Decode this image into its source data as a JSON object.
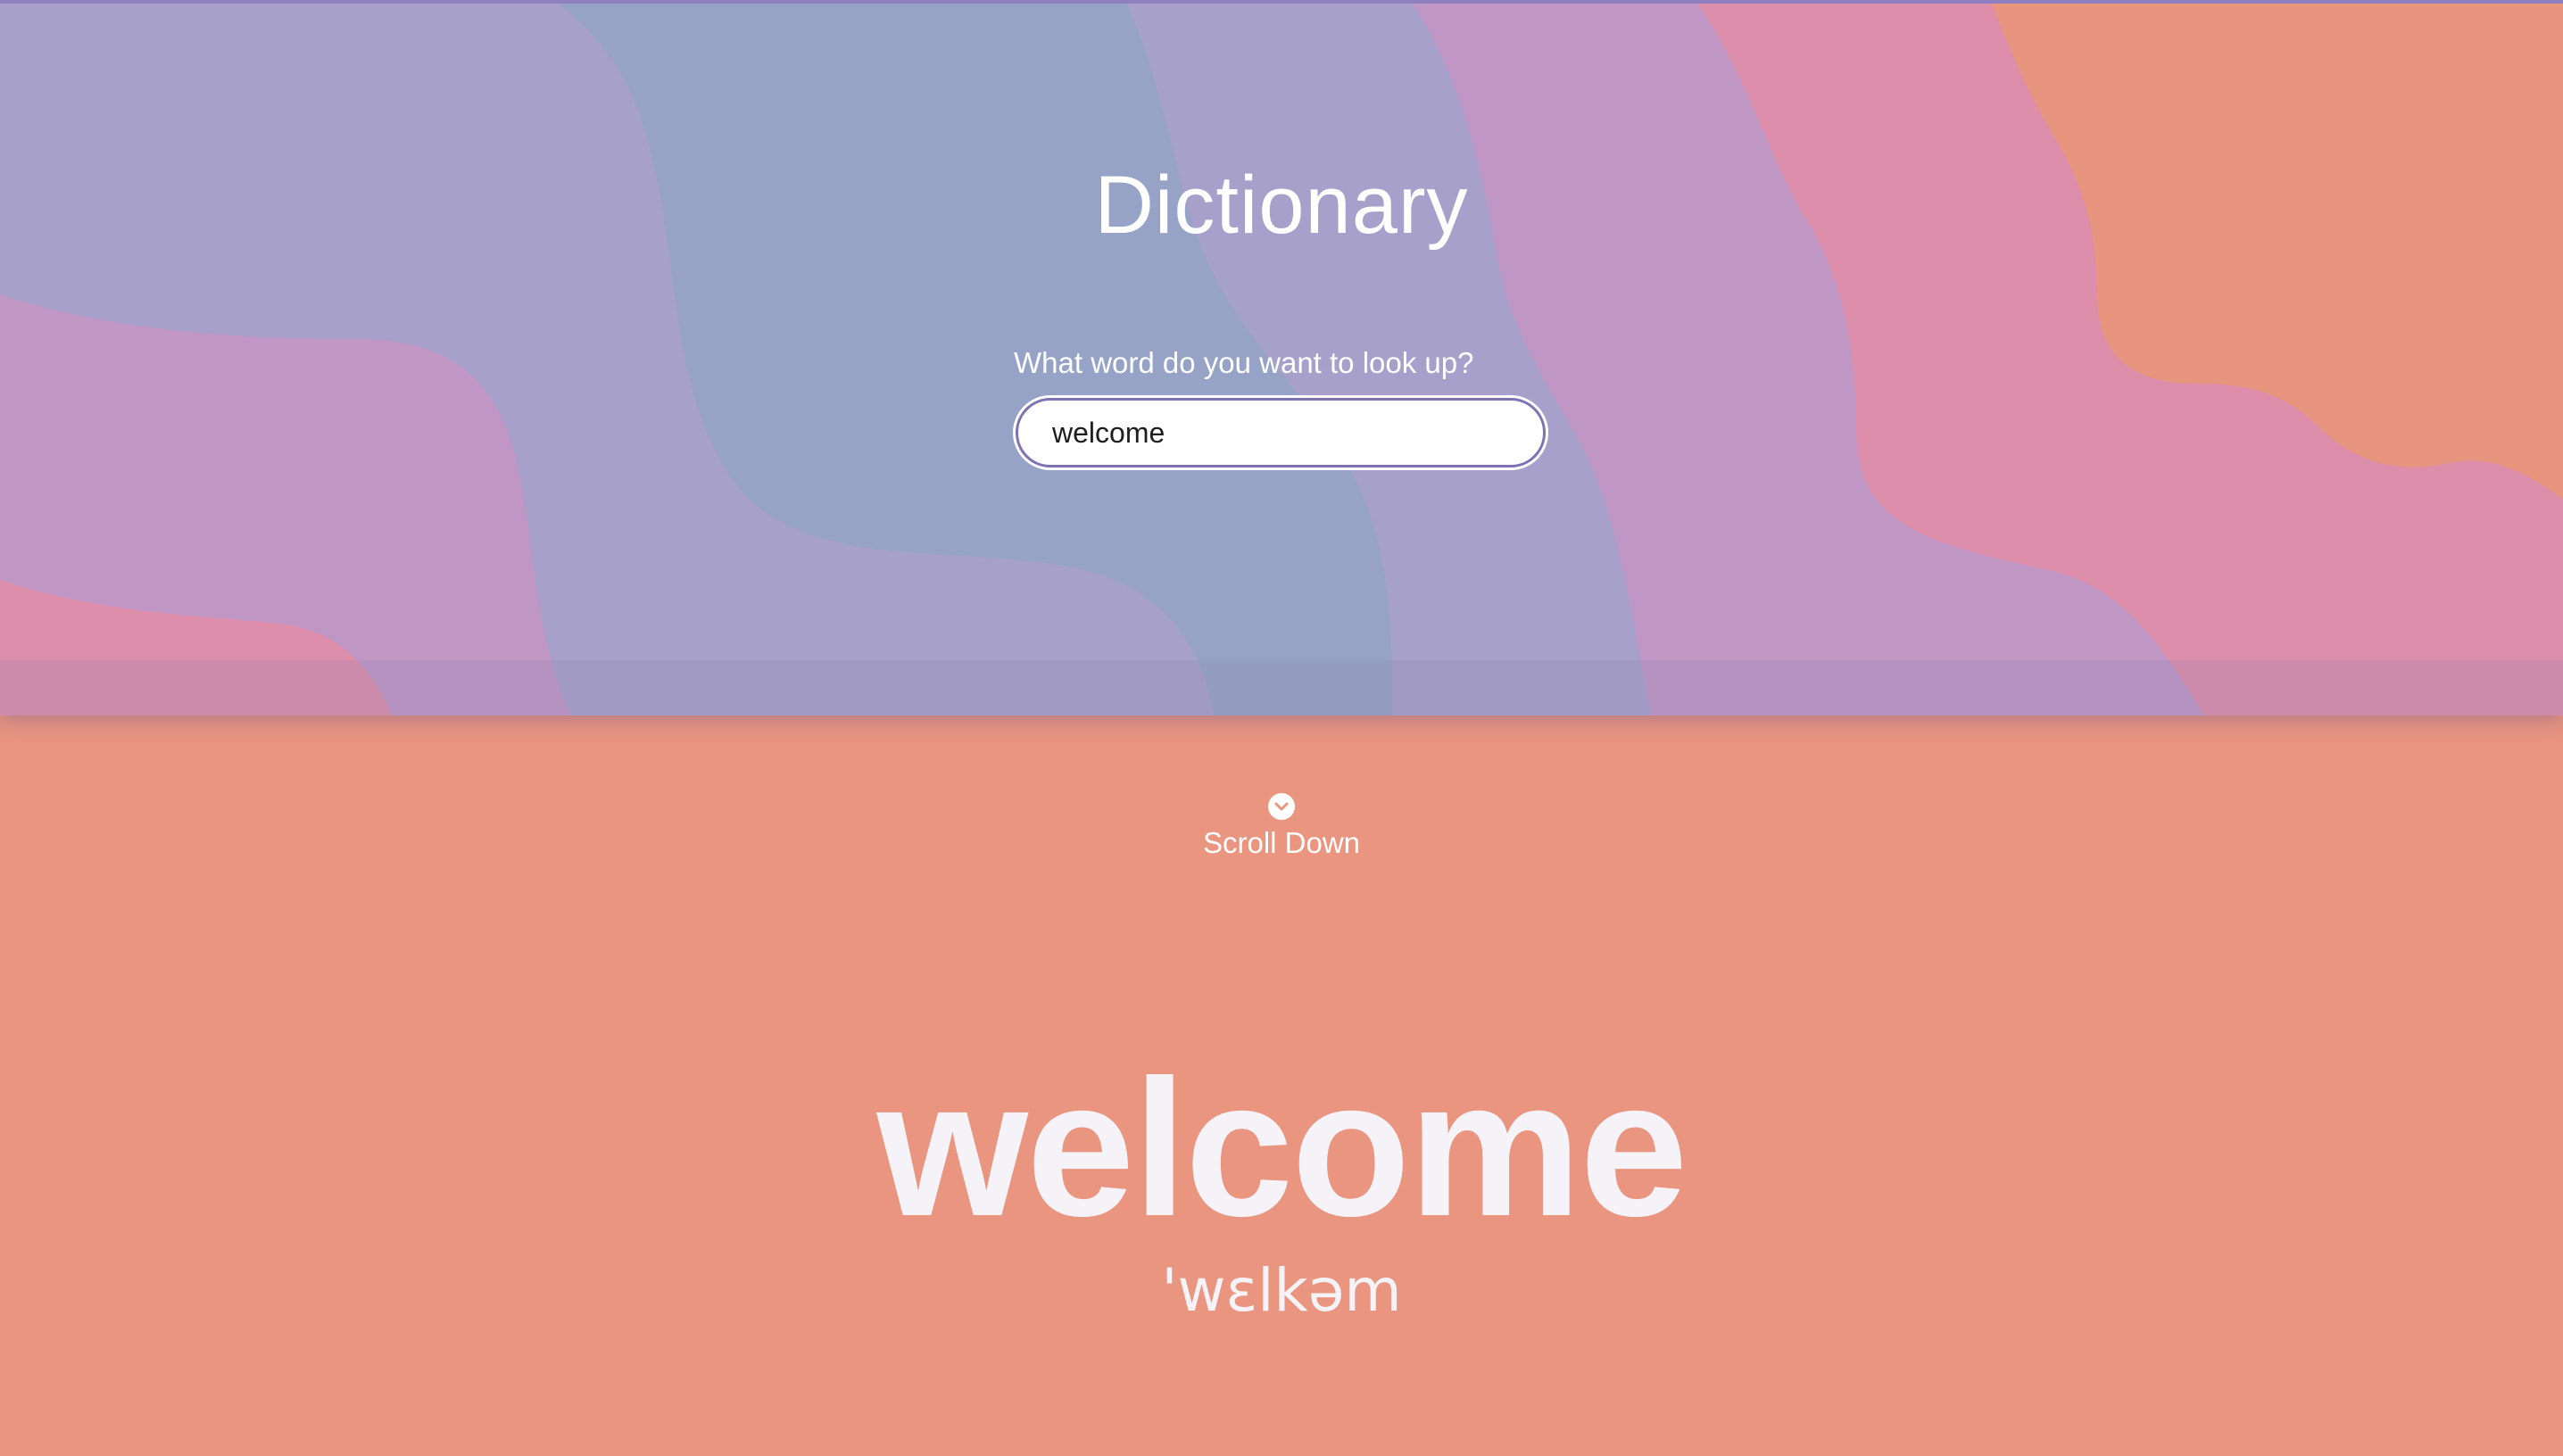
{
  "header": {
    "title": "Dictionary",
    "prompt": "What word do you want to look up?"
  },
  "search": {
    "value": "welcome",
    "placeholder": ""
  },
  "scroll": {
    "icon": "chevron-down-circle-icon",
    "label": "Scroll Down"
  },
  "result": {
    "word": "welcome",
    "phonetic": "'wɛlkəm"
  },
  "colors": {
    "hero_base": "#96a3c6",
    "lavender": "#a6a0ca",
    "mauve": "#c096c4",
    "pink": "#dc8eab",
    "peach": "#e8957f",
    "result_background": "#e9957f",
    "text": "#ffffff"
  }
}
